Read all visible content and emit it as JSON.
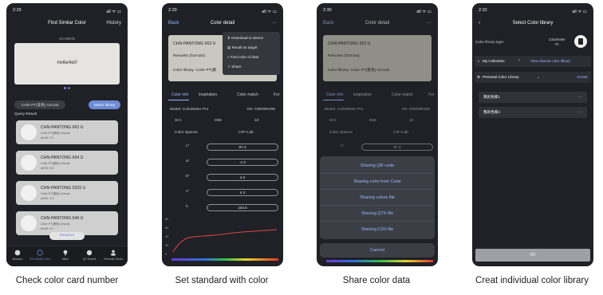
{
  "captions": [
    "Check color card number",
    "Set standard with color",
    "Share color data",
    "Creat individual color library"
  ],
  "phone1": {
    "time": "2:29",
    "signal": "all ᯤ ▭",
    "title": "Find Similar Color",
    "history": "History",
    "hex_top": "SCA667B",
    "hex_main": "#e6e4e0",
    "library_pill": "Color-PT(美色) Uncoat",
    "select_pill": "Select library",
    "query_label": "Query Result",
    "results": [
      {
        "name": "CHN-PANTONG 663 U",
        "lib": "Color-PT(美色) Uncoat",
        "de": "de%0: 0.1"
      },
      {
        "name": "CHN-PANTONG 664 U",
        "lib": "Color-PT(美色) Uncoat",
        "de": "de%0: 0.8"
      },
      {
        "name": "CHN-PANTONG 5315 U",
        "lib": "Color-PT(美色) Uncoat",
        "de": "de%0: 0.5"
      },
      {
        "name": "CHN-PANTONG 649 U",
        "lib": "Color-PT(美色) Uncoat",
        "de": "de%0: 0.1"
      }
    ],
    "measure_btn": "Measure",
    "tabs": [
      "Measure",
      "Find Similar Color",
      "Meter",
      "QC Record",
      "Personal Center"
    ]
  },
  "phone2": {
    "time": "2:29",
    "signal": "all ᯤ ▭",
    "back": "Back",
    "title": "Color detail",
    "more": "···",
    "card_name": "CHN-PANTONG 663 U",
    "remarks": "Remarks (formula):",
    "library": "Color library: Color-PT(美",
    "menu": [
      "Download to device",
      "Recall as target",
      "Find color of data",
      "Share"
    ],
    "tabs": [
      "Color info",
      "Inspiration",
      "Color match",
      "For"
    ],
    "model_label": "Model: ColorMeter Pro",
    "sn_label": "SN: CM0000196",
    "opt_row": [
      "SCI",
      "D65",
      "10"
    ],
    "color_space": "Color Spaces",
    "color_space_val": "CIP+Lab",
    "fields": [
      {
        "k": "L*",
        "v": "87.3"
      },
      {
        "k": "a*",
        "v": "-1.0"
      },
      {
        "k": "b*",
        "v": "4.2"
      },
      {
        "k": "c*",
        "v": "4.3"
      },
      {
        "k": "h",
        "v": "103.6"
      }
    ],
    "chart_ticks": [
      "80",
      "60",
      "40",
      "20",
      "0"
    ]
  },
  "phone3": {
    "time": "2:30",
    "signal": "all ᯤ ▭",
    "back": "Back",
    "title": "Color detail",
    "more": "···",
    "card_name": "CHN-PANTONG 663 U",
    "remarks": "Remarks (formula):",
    "library": "Color library: Color-PT(美色) Uncoat",
    "tabs": [
      "Color info",
      "Inspiration",
      "Color match",
      "For"
    ],
    "model_label": "Model: ColorMeter Pro",
    "sn_label": "SN: CM0000196",
    "opt_row": [
      "SCI",
      "D65",
      "10"
    ],
    "color_space": "Color Spaces",
    "color_space_val": "CIP+Lab",
    "l_field": {
      "k": "L*",
      "v": "87.3"
    },
    "share_items": [
      "Sharing QR code",
      "Sharing color from Code",
      "Sharing colors file",
      "Sharing QTX file",
      "Sharing CSV file"
    ],
    "cancel": "Cancel"
  },
  "phone4": {
    "time": "2:32",
    "signal": "all ᯤ ▭",
    "title": "Select Color library",
    "lib_type": "Color library type:",
    "meter_name": "Colormeter",
    "meter_sub": "#1",
    "my_collection": "My Collection",
    "view_shared": "View shared color library",
    "personal": "Personal Color Library",
    "create": "Create",
    "libs": [
      "我的色库1",
      "我的色库2"
    ],
    "ok": "OK"
  },
  "colors": {
    "bg": "#1f2126",
    "accent": "#9ab8ff",
    "card": "#cfcfcf"
  }
}
